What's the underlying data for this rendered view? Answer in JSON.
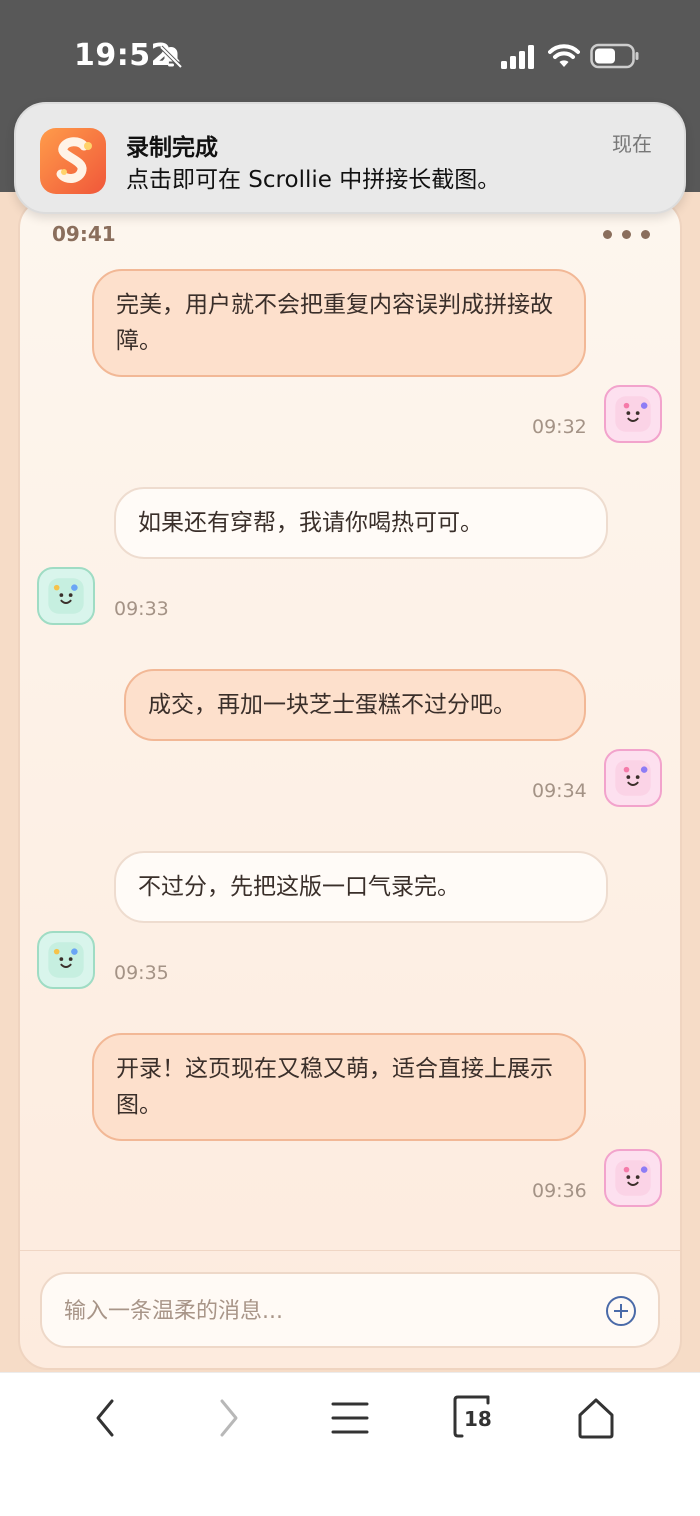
{
  "status_bar": {
    "time": "19:52"
  },
  "notification": {
    "title": "录制完成",
    "body": "点击即可在 Scrollie 中拼接长截图。",
    "time": "现在"
  },
  "chat": {
    "header_time": "09:41",
    "messages": [
      {
        "side": "out",
        "text": "完美，用户就不会把重复内容误判成拼接故障。",
        "time": "09:32"
      },
      {
        "side": "in",
        "text": "如果还有穿帮，我请你喝热可可。",
        "time": "09:33"
      },
      {
        "side": "out",
        "text": "成交，再加一块芝士蛋糕不过分吧。",
        "time": "09:34"
      },
      {
        "side": "in",
        "text": "不过分，先把这版一口气录完。",
        "time": "09:35"
      },
      {
        "side": "out",
        "text": "开录！这页现在又稳又萌，适合直接上展示图。",
        "time": "09:36"
      }
    ],
    "input": {
      "placeholder": "输入一条温柔的消息...",
      "value": ""
    }
  },
  "browser_nav": {
    "tab_count": "18"
  },
  "colors": {
    "outgoing_bubble": "#fde0cc",
    "incoming_bubble": "#fffbf7",
    "accent_pink": "#f2a3cc",
    "accent_mint": "#9fdcc4"
  },
  "icons": [
    "bell-slash-icon",
    "signal-icon",
    "wifi-icon",
    "battery-icon",
    "app-icon",
    "more-icon",
    "smile-avatar-icon",
    "add-circle-icon",
    "back-icon",
    "forward-icon",
    "menu-icon",
    "tabs-icon",
    "home-icon"
  ]
}
